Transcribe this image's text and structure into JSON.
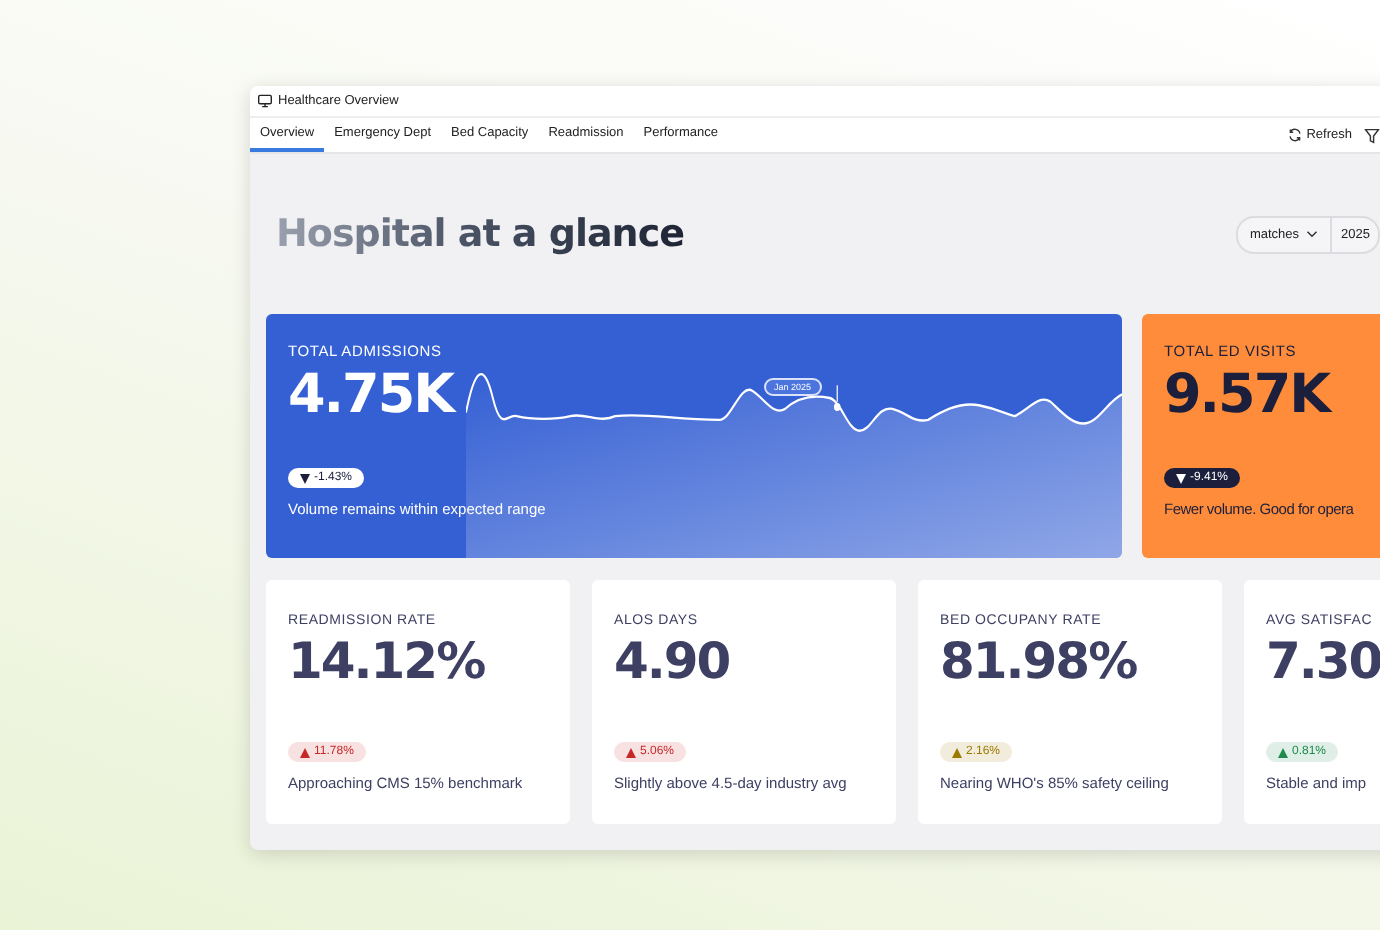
{
  "window": {
    "title": "Healthcare Overview"
  },
  "tabs": [
    {
      "label": "Overview",
      "selected": true
    },
    {
      "label": "Emergency Dept",
      "selected": false
    },
    {
      "label": "Bed Capacity",
      "selected": false
    },
    {
      "label": "Readmission",
      "selected": false
    },
    {
      "label": "Performance",
      "selected": false
    }
  ],
  "toolbar": {
    "refresh": "Refresh"
  },
  "heading": "Hospital at a glance",
  "filter": {
    "mode": "matches",
    "year": "2025"
  },
  "hero_cards": [
    {
      "label": "TOTAL ADMISSIONS",
      "value": "4.75K",
      "color": "#3560d4",
      "badge": {
        "text": "-1.43%",
        "kind": "down",
        "color": "#1b1f3b"
      },
      "note": "Volume remains within expected range",
      "tooltip": "Jan 2025"
    },
    {
      "label": "TOTAL ED VISITS",
      "value": "9.57K",
      "color": "#ff8c3a",
      "badge": {
        "text": "-9.41%",
        "kind": "down",
        "color": "#ffffff"
      },
      "note": "Fewer volume. Good for opera"
    }
  ],
  "kpi_cards": [
    {
      "label": "READMISSION RATE",
      "value": "14.12%",
      "badge": {
        "text": "11.78%",
        "kind": "up",
        "color": "#c62828"
      },
      "note": "Approaching CMS 15% benchmark"
    },
    {
      "label": "ALOS DAYS",
      "value": "4.90",
      "badge": {
        "text": "5.06%",
        "kind": "up",
        "color": "#c62828"
      },
      "note": "Slightly above 4.5-day industry avg"
    },
    {
      "label": "BED OCCUPANY RATE",
      "value": "81.98%",
      "badge": {
        "text": "2.16%",
        "kind": "up",
        "color": "#9a7b00"
      },
      "note": "Nearing WHO's 85% safety ceiling"
    },
    {
      "label": "AVG SATISFAC",
      "value": "7.30",
      "badge": {
        "text": "0.81%",
        "kind": "up",
        "color": "#1e8a4c"
      },
      "note": "Stable and imp"
    }
  ]
}
